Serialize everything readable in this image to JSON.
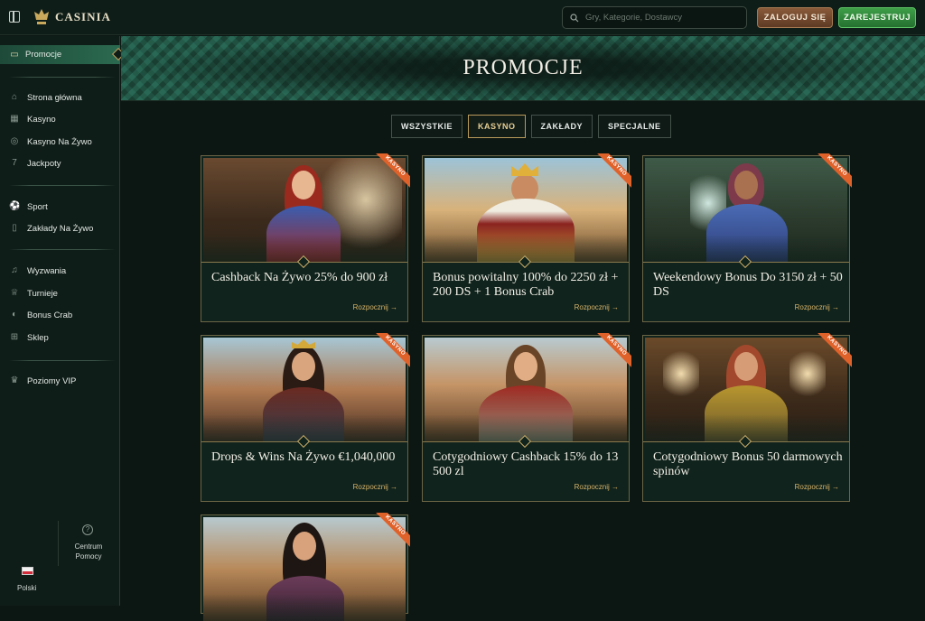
{
  "header": {
    "logo_text": "CASINIA",
    "search_placeholder": "Gry, Kategorie, Dostawcy",
    "login_label": "ZALOGUJ SIĘ",
    "register_label": "ZAREJESTRUJ"
  },
  "sidebar": {
    "active": {
      "label": "Promocje",
      "icon": "gift-icon"
    },
    "groups": [
      [
        {
          "label": "Strona główna",
          "icon": "home-icon"
        },
        {
          "label": "Kasyno",
          "icon": "casino-icon"
        },
        {
          "label": "Kasyno Na Żywo",
          "icon": "live-casino-icon"
        },
        {
          "label": "Jackpoty",
          "icon": "jackpot-icon"
        }
      ],
      [
        {
          "label": "Sport",
          "icon": "ball-icon"
        },
        {
          "label": "Zakłady Na Żywo",
          "icon": "live-bet-icon"
        }
      ],
      [
        {
          "label": "Wyzwania",
          "icon": "bell-icon"
        },
        {
          "label": "Turnieje",
          "icon": "trophy-icon"
        },
        {
          "label": "Bonus Crab",
          "icon": "crab-icon"
        },
        {
          "label": "Sklep",
          "icon": "shop-icon"
        }
      ],
      [
        {
          "label": "Poziomy VIP",
          "icon": "crown-icon"
        }
      ]
    ],
    "footer": {
      "language": "Polski",
      "help": "Centrum Pomocy"
    }
  },
  "page": {
    "title": "PROMOCJE",
    "tabs": [
      {
        "label": "WSZYSTKIE",
        "active": false
      },
      {
        "label": "KASYNO",
        "active": true
      },
      {
        "label": "ZAKŁADY",
        "active": false
      },
      {
        "label": "SPECJALNE",
        "active": false
      }
    ]
  },
  "promos": [
    {
      "badge": "KASYNO",
      "title": "Cashback Na Żywo 25% do 900 zł",
      "cta": "Rozpocznij →"
    },
    {
      "badge": "KASYNO",
      "title": "Bonus powitalny 100% do 2250 zł + 200 DS + 1 Bonus Crab",
      "cta": "Rozpocznij →"
    },
    {
      "badge": "KASYNO",
      "title": "Weekendowy Bonus Do 3150 zł + 50 DS",
      "cta": "Rozpocznij →"
    },
    {
      "badge": "KASYNO",
      "title": "Drops & Wins Na Żywo €1,040,000",
      "cta": "Rozpocznij →"
    },
    {
      "badge": "KASYNO",
      "title": "Cotygodniowy Cashback 15% do 13 500 zl",
      "cta": "Rozpocznij →"
    },
    {
      "badge": "KASYNO",
      "title": "Cotygodniowy Bonus 50 darmowych spinów",
      "cta": "Rozpocznij →"
    },
    {
      "badge": "KASYNO",
      "title": "",
      "cta": ""
    }
  ],
  "colors": {
    "accent_gold": "#c8ab6a",
    "register_green": "#2f8a3a",
    "login_brown": "#7a4e33",
    "badge_orange": "#e0622b"
  }
}
